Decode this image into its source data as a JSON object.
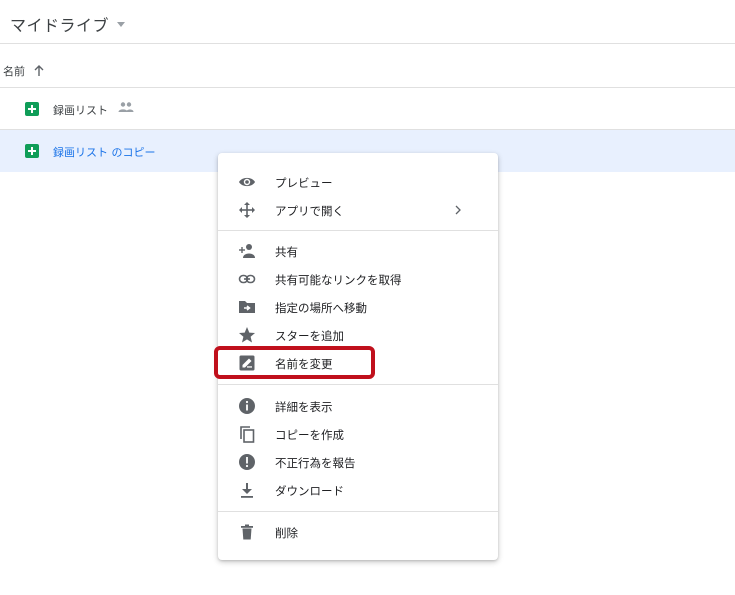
{
  "header": {
    "title": "マイドライブ"
  },
  "columns": {
    "name_label": "名前"
  },
  "files": [
    {
      "name": "録画リスト",
      "shared": true
    },
    {
      "name": "録画リスト のコピー",
      "shared": false,
      "selected": true
    }
  ],
  "menu": {
    "items": [
      {
        "label": "プレビュー",
        "icon": "eye-icon"
      },
      {
        "label": "アプリで開く",
        "icon": "move-arrows-icon",
        "has_submenu": true
      },
      {
        "label": "共有",
        "icon": "add-person-icon"
      },
      {
        "label": "共有可能なリンクを取得",
        "icon": "link-icon"
      },
      {
        "label": "指定の場所へ移動",
        "icon": "folder-move-icon"
      },
      {
        "label": "スターを追加",
        "icon": "star-icon"
      },
      {
        "label": "名前を変更",
        "icon": "rename-icon"
      },
      {
        "label": "詳細を表示",
        "icon": "info-icon"
      },
      {
        "label": "コピーを作成",
        "icon": "copy-icon"
      },
      {
        "label": "不正行為を報告",
        "icon": "report-icon"
      },
      {
        "label": "ダウンロード",
        "icon": "download-icon"
      },
      {
        "label": "削除",
        "icon": "trash-icon"
      }
    ]
  },
  "colors": {
    "selected_row": "#e8f0fe",
    "sheets_green": "#0f9d58",
    "highlight": "#c0101c",
    "link_blue": "#1a73e8"
  }
}
